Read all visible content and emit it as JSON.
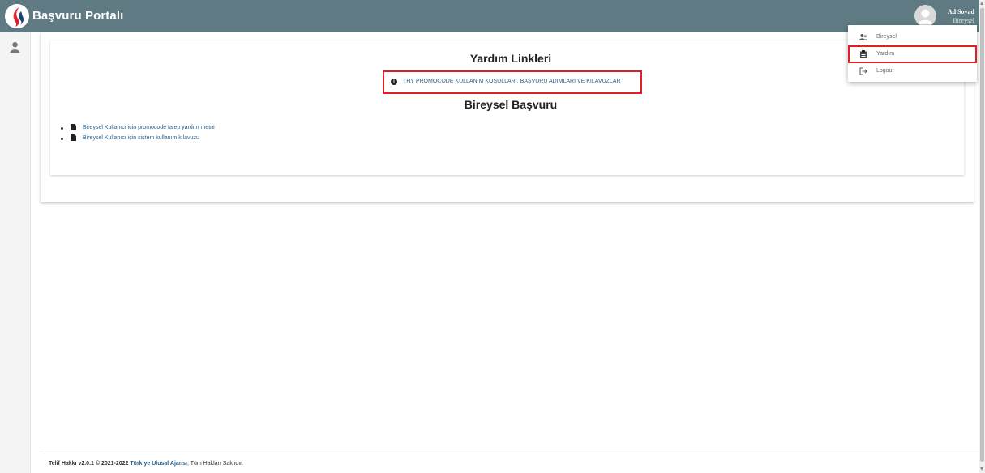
{
  "header": {
    "app_title": "Başvuru Portalı",
    "user_name": "Ad Soyad",
    "user_role": "Bireysel"
  },
  "help": {
    "title": "Yardım Linkleri",
    "link_text": "THY PROMOCODE KULLANIM KOŞULLARI, BAŞVURU ADIMLARI VE KILAVUZLAR"
  },
  "section": {
    "title": "Bireysel Başvuru",
    "items": [
      {
        "label": "Bireysel Kullanıcı için promocode talep yardım metni"
      },
      {
        "label": "Bireysel Kullanıcı için sistem kullanım kılavuzu"
      }
    ]
  },
  "menu": {
    "items": [
      {
        "label": "Bireysel",
        "icon": "users-icon"
      },
      {
        "label": "Yardım",
        "icon": "clipboard-icon"
      },
      {
        "label": "Logout",
        "icon": "logout-icon"
      }
    ]
  },
  "footer": {
    "version": "Telif Hakkı v2.0.1 © 2021-2022",
    "org": "Türkiye Ulusal Ajansı",
    "rights": ", Tüm Hakları Saklıdır."
  },
  "colors": {
    "topbar": "#5f7a82",
    "highlight": "#e01f26",
    "link": "#2a5f8a"
  }
}
